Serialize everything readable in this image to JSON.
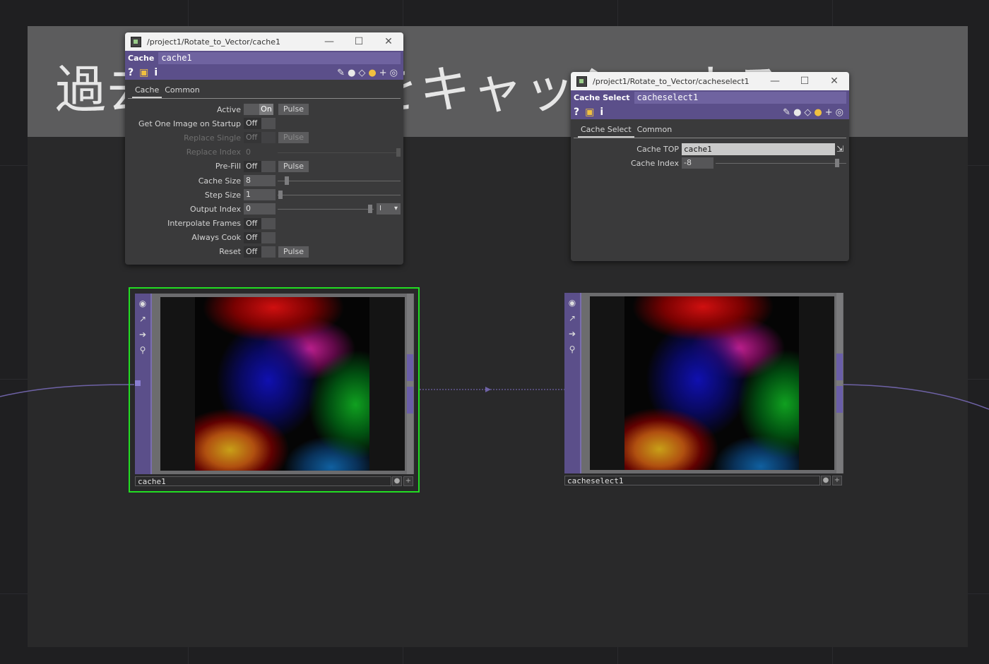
{
  "annotation": {
    "title": "過去フレームをキャッシュする"
  },
  "cache_window": {
    "path": "/project1/Rotate_to_Vector/cache1",
    "op_type": "Cache",
    "op_name": "cache1",
    "tabs": [
      "Cache",
      "Common"
    ],
    "params": {
      "active": {
        "label": "Active",
        "value": "On",
        "pulse": "Pulse"
      },
      "get_one_image": {
        "label": "Get One Image on Startup",
        "value": "Off"
      },
      "replace_single": {
        "label": "Replace Single",
        "value": "Off",
        "pulse": "Pulse"
      },
      "replace_index": {
        "label": "Replace Index",
        "value": "0"
      },
      "pre_fill": {
        "label": "Pre-Fill",
        "value": "Off",
        "pulse": "Pulse"
      },
      "cache_size": {
        "label": "Cache Size",
        "value": "8"
      },
      "step_size": {
        "label": "Step Size",
        "value": "1"
      },
      "output_index": {
        "label": "Output Index",
        "value": "0",
        "unit": "I"
      },
      "interpolate_frames": {
        "label": "Interpolate Frames",
        "value": "Off"
      },
      "always_cook": {
        "label": "Always Cook",
        "value": "Off"
      },
      "reset": {
        "label": "Reset",
        "value": "Off",
        "pulse": "Pulse"
      }
    }
  },
  "cacheselect_window": {
    "path": "/project1/Rotate_to_Vector/cacheselect1",
    "op_type": "Cache Select",
    "op_name": "cacheselect1",
    "tabs": [
      "Cache Select",
      "Common"
    ],
    "params": {
      "cache_top": {
        "label": "Cache TOP",
        "value": "cache1"
      },
      "cache_index": {
        "label": "Cache Index",
        "value": "-8"
      }
    }
  },
  "nodes": {
    "cache1": {
      "name": "cache1"
    },
    "cacheselect1": {
      "name": "cacheselect1"
    }
  },
  "window_buttons": {
    "minimize": "—",
    "maximize": "☐",
    "close": "✕"
  },
  "toolbar_glyphs": {
    "help": "?",
    "python_help": "⌘",
    "info": "i"
  },
  "colors": {
    "op_header": "#5b4f8a",
    "selected_outline": "#22dd22",
    "wire": "#6e62a6"
  }
}
